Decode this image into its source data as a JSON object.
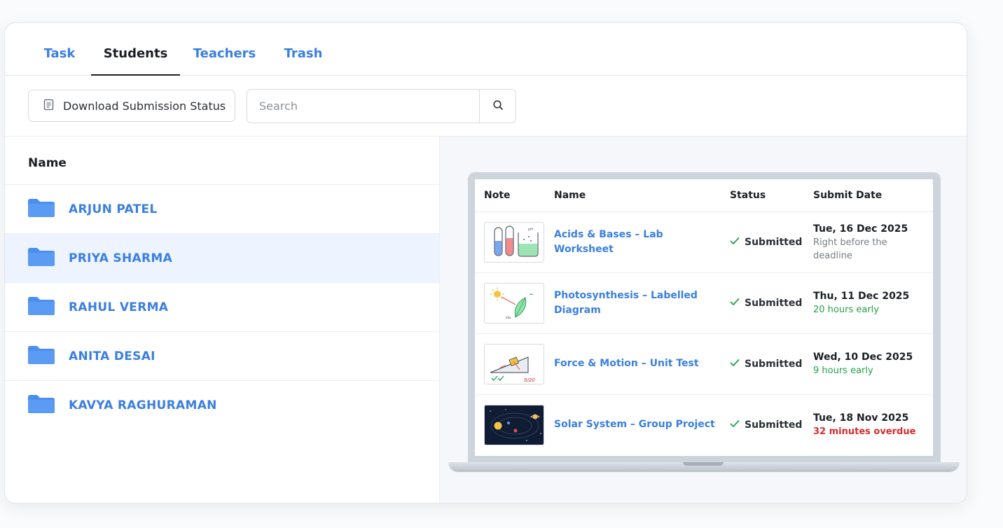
{
  "tabs": [
    {
      "label": "Task"
    },
    {
      "label": "Students"
    },
    {
      "label": "Teachers"
    },
    {
      "label": "Trash"
    }
  ],
  "active_tab": "Students",
  "toolbar": {
    "download_label": "Download Submission Status",
    "search_placeholder": "Search"
  },
  "students": {
    "header": "Name",
    "items": [
      {
        "name": "ARJUN PATEL"
      },
      {
        "name": "PRIYA SHARMA",
        "highlighted": true
      },
      {
        "name": "RAHUL VERMA"
      },
      {
        "name": "ANITA DESAI"
      },
      {
        "name": "KAVYA RAGHURAMAN"
      }
    ]
  },
  "submissions": {
    "columns": [
      "Note",
      "Name",
      "Status",
      "Submit Date"
    ],
    "rows": [
      {
        "thumb": "test-tubes-thumbnail",
        "name": "Acids & Bases – Lab Worksheet",
        "status": "Submitted",
        "date": "Tue, 16 Dec 2025",
        "note": "Right before the deadline",
        "note_color": "#777d85"
      },
      {
        "thumb": "photosynthesis-thumbnail",
        "name": "Photosynthesis – Labelled Diagram",
        "status": "Submitted",
        "date": "Thu, 11 Dec 2025",
        "note": "20 hours early",
        "note_color": "#23a04b"
      },
      {
        "thumb": "inclined-plane-thumbnail",
        "name": "Force & Motion – Unit Test",
        "status": "Submitted",
        "date": "Wed, 10 Dec 2025",
        "note": "9 hours early",
        "note_color": "#23a04b",
        "thumb_score": "9/20"
      },
      {
        "thumb": "solar-system-thumbnail",
        "name": "Solar System – Group Project",
        "status": "Submitted",
        "date": "Tue, 18 Nov 2025",
        "note": "32 minutes overdue",
        "note_color": "#d62d2d"
      }
    ]
  },
  "colors": {
    "accent": "#3a7fe0",
    "folder": "#4a8ff0",
    "highlight_row": "#edf4ff",
    "success": "#23a04b",
    "danger": "#d62d2d"
  }
}
